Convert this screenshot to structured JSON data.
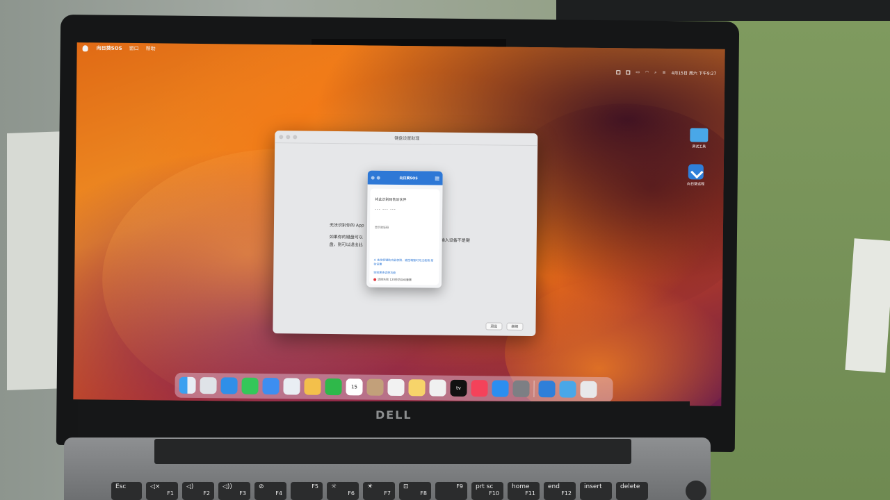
{
  "menubar": {
    "app": "向日葵SOS",
    "items": [
      "窗口",
      "帮助"
    ]
  },
  "status": {
    "datetime": "4月15日 周六 下午9:27"
  },
  "desktop_icons": [
    {
      "label": "调试工具"
    },
    {
      "label": "向日葵远程"
    }
  ],
  "setup_window": {
    "title": "键盘设置助理",
    "body_line1": "无法识别你的 App",
    "body_line2": "如果你的键盘可以",
    "body_line3": "盘，则可以退出此",
    "body_right": "输入设备不是键",
    "quit_button": "退出",
    "continue_button": "继续"
  },
  "sos_window": {
    "title": "向日葵SOS",
    "label_code": "将此识别码告诉伙伴",
    "code": "--- --- ---",
    "show_label": "显示验证码",
    "notice": "※ 未授权辅助功能权限，被控端暂时无法使用 前往设置",
    "more": "体验更多远控功能",
    "footer": "远控失败 120秒后自动重置"
  },
  "dock": {
    "calendar_day": "15",
    "tv_label": "tv"
  },
  "brand": "DELL",
  "keyboard": {
    "keys": [
      {
        "top": "Esc",
        "sub": ""
      },
      {
        "top": "◁×",
        "sub": "F1"
      },
      {
        "top": "◁)",
        "sub": "F2"
      },
      {
        "top": "◁))",
        "sub": "F3"
      },
      {
        "top": "⊘",
        "sub": "F4"
      },
      {
        "top": "",
        "sub": "F5"
      },
      {
        "top": "☼",
        "sub": "F6"
      },
      {
        "top": "☀",
        "sub": "F7"
      },
      {
        "top": "⊡",
        "sub": "F8"
      },
      {
        "top": "",
        "sub": "F9"
      },
      {
        "top": "prt sc",
        "sub": "F10"
      },
      {
        "top": "home",
        "sub": "F11"
      },
      {
        "top": "end",
        "sub": "F12"
      },
      {
        "top": "insert",
        "sub": ""
      },
      {
        "top": "delete",
        "sub": ""
      }
    ]
  },
  "colors": {
    "sos_blue": "#2e78d6",
    "wallpaper_orange": "#f08f24"
  }
}
